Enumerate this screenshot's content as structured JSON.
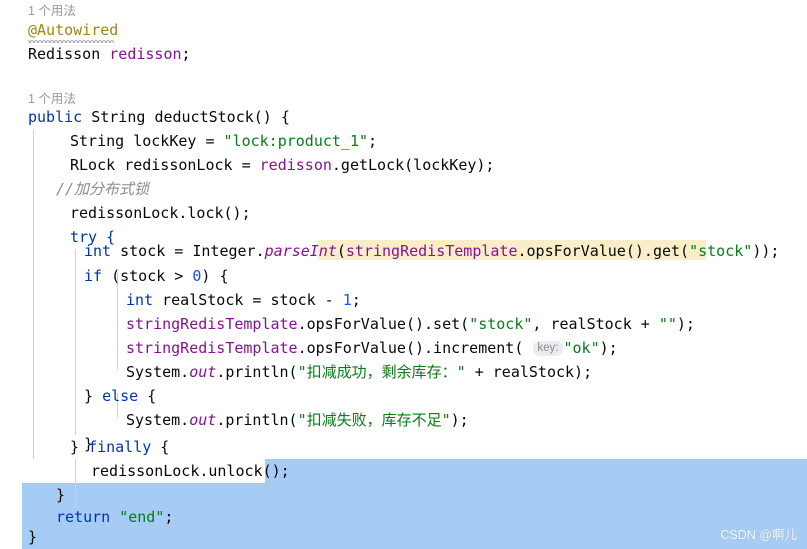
{
  "editor": {
    "app": "IntelliJ IDEA code editor",
    "language": "Java",
    "usage_hint_field": "1 个用法",
    "usage_hint_method": "1 个用法",
    "watermark": "CSDN @啊儿",
    "colors": {
      "background": "#ffffff",
      "selection": "#a6cbf5",
      "search_highlight": "#faeec8",
      "keyword": "#0033b3",
      "string": "#067d17",
      "number": "#1750eb",
      "field": "#871094",
      "annotation": "#9e880d",
      "comment": "#8c8c8c",
      "text": "#080808",
      "indent_guide": "#d0d0d0",
      "hint_pill_bg": "#ebecf0",
      "hint_pill_text": "#888c93"
    }
  },
  "code": {
    "annotation": "@Autowired",
    "field_declaration": {
      "type": "Redisson",
      "name": "redisson",
      "semicolon": ";"
    },
    "method_signature": {
      "modifier": "public",
      "return_type": "String",
      "name": "deductStock",
      "params": "()",
      "brace": "{"
    },
    "line_lockkey": {
      "type": "String",
      "name": "lockKey",
      "eq": "=",
      "value": "\"lock:product_1\"",
      "semicolon": ";"
    },
    "line_rlock": {
      "type": "RLock",
      "name": "redissonLock",
      "eq": "=",
      "field": "redisson",
      "call": ".getLock(lockKey);"
    },
    "comment_lock": "//加分布式锁",
    "line_lock": "redissonLock.lock();",
    "line_try": "try {",
    "line_stock": {
      "kw": "int",
      "rest": "stock = Integer.",
      "static_method": "parseInt",
      "open": "(",
      "hl_field": "stringRedisTemplate",
      "hl_mid": ".opsForValue().get(",
      "hl_str": "\"stock\"",
      "hl_close": ")",
      "tail": ");"
    },
    "line_if": {
      "kw": "if",
      "pre": " (stock > ",
      "num": "0",
      "post": ") {"
    },
    "line_realstock": {
      "kw": "int",
      "mid": " realStock = stock - ",
      "num": "1",
      "end": ";"
    },
    "line_set": {
      "field": "stringRedisTemplate",
      "mid": ".opsForValue().set(",
      "str1": "\"stock\"",
      "mid2": ", realStock + ",
      "str2": "\"\"",
      "end": ");"
    },
    "line_increment": {
      "field": "stringRedisTemplate",
      "mid": ".opsForValue().increment( ",
      "hint": "key:",
      "str": "\"ok\"",
      "end": ");"
    },
    "line_println_success": {
      "pre": "System.",
      "static_field": "out",
      "mid": ".println(",
      "str": "\"扣减成功，剩余库存：\"",
      "end": " + realStock);"
    },
    "line_else": "} else {",
    "line_println_fail": {
      "pre": "System.",
      "static_field": "out",
      "mid": ".println(",
      "str": "\"扣减失败，库存不足\"",
      "end": ");"
    },
    "line_close_else": "}",
    "line_finally": {
      "pre": "} ",
      "kw": "finally",
      "post": " {"
    },
    "line_unlock": "redissonLock.unlock();",
    "line_close_finally": "}",
    "line_return": {
      "kw": "return",
      "str": " \"end\"",
      "end": ";"
    },
    "line_close_method": "}"
  }
}
